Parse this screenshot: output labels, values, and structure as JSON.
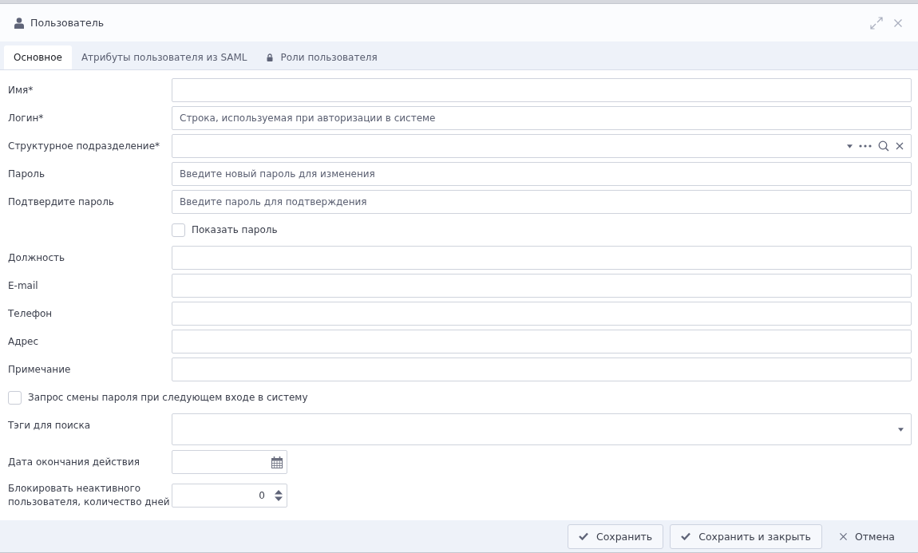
{
  "window": {
    "title": "Пользователь"
  },
  "tabs": [
    {
      "label": "Основное",
      "selected": true,
      "locked": false
    },
    {
      "label": "Атрибуты пользователя из SAML",
      "selected": false,
      "locked": false
    },
    {
      "label": "Роли пользователя",
      "selected": false,
      "locked": true
    }
  ],
  "fields": [
    {
      "kind": "text",
      "label": "Имя*"
    },
    {
      "kind": "text",
      "label": "Логин*",
      "placeholder": "Строка, используемая при авторизации в системе"
    },
    {
      "kind": "lookup",
      "label": "Структурное подразделение*"
    },
    {
      "kind": "text",
      "label": "Пароль",
      "placeholder": "Введите новый пароль для изменения"
    },
    {
      "kind": "text",
      "label": "Подтвердите пароль",
      "placeholder": "Введите пароль для подтверждения"
    },
    {
      "kind": "checkbox",
      "label": "Показать пароль",
      "checked": false
    },
    {
      "kind": "text",
      "label": "Должность"
    },
    {
      "kind": "text",
      "label": "E-mail"
    },
    {
      "kind": "text",
      "label": "Телефон"
    },
    {
      "kind": "text",
      "label": "Адрес"
    },
    {
      "kind": "text",
      "label": "Примечание"
    },
    {
      "kind": "wide-checkbox",
      "label": "Запрос смены пароля при следующем входе в систему",
      "checked": false
    },
    {
      "kind": "tags",
      "label": "Тэги для поиска"
    },
    {
      "kind": "date",
      "label": "Дата окончания действия"
    },
    {
      "kind": "number",
      "label": "Блокировать неактивного пользователя, количество дней",
      "value": "0"
    }
  ],
  "buttons": [
    {
      "label": "Сохранить",
      "kind": "save"
    },
    {
      "label": "Сохранить и закрыть",
      "kind": "save"
    },
    {
      "label": "Отмена",
      "kind": "cancel"
    }
  ]
}
